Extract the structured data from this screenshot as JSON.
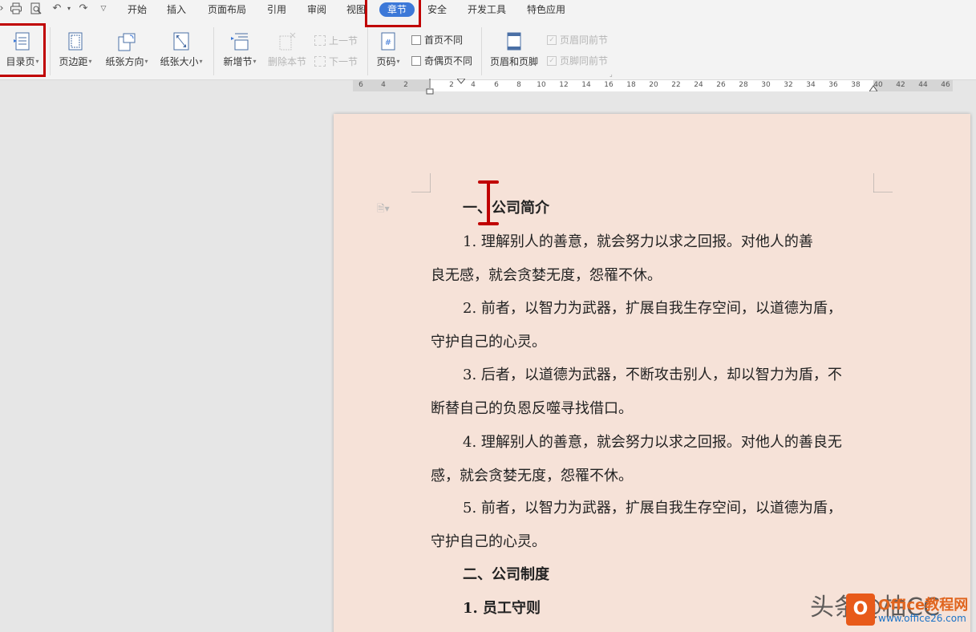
{
  "menu": {
    "items": [
      "开始",
      "插入",
      "页面布局",
      "引用",
      "审阅",
      "视图"
    ],
    "active": "章节",
    "after": [
      "安全",
      "开发工具",
      "特色应用"
    ]
  },
  "quick_access_icons": [
    "print-icon",
    "print-preview-icon",
    "undo-icon",
    "redo-icon",
    "customize-icon"
  ],
  "ribbon": {
    "toc_page": "目录页",
    "margins": "页边距",
    "orientation": "纸张方向",
    "paper_size": "纸张大小",
    "new_section": "新增节",
    "delete_section": "删除本节",
    "prev_section": "上一节",
    "next_section": "下一节",
    "page_number": "页码",
    "first_page_diff": "首页不同",
    "odd_even_diff": "奇偶页不同",
    "header_footer": "页眉和页脚",
    "header_same_prev": "页眉同前节",
    "footer_same_prev": "页脚同前节"
  },
  "ruler_ticks": [
    "6",
    "4",
    "2",
    "2",
    "4",
    "6",
    "8",
    "10",
    "12",
    "14",
    "16",
    "18",
    "20",
    "22",
    "24",
    "26",
    "28",
    "30",
    "32",
    "34",
    "36",
    "38",
    "40",
    "42",
    "44",
    "46"
  ],
  "document": {
    "heading1": "一、公司简介",
    "lines": [
      "1.    理解别人的善意，就会努力以求之回报。对他人的善",
      "良无感，就会贪婪无度，怨罹不休。",
      "2. 前者，以智力为武器，扩展自我生存空间，以道德为盾，",
      "守护自己的心灵。",
      "3. 后者，以道德为武器，不断攻击别人，却以智力为盾，不",
      "断替自己的负恩反噬寻找借口。",
      "4. 理解别人的善意，就会努力以求之回报。对他人的善良无",
      "感，就会贪婪无度，怨罹不休。",
      "5. 前者，以智力为武器，扩展自我生存空间，以道德为盾，",
      "守护自己的心灵。"
    ],
    "heading2": "二、公司制度",
    "heading3": "1. 员工守则"
  },
  "watermark": {
    "text": "头条@柚CC",
    "logo_text": "O",
    "brand": "Office教程网",
    "url": "www.office26.com"
  },
  "colors": {
    "accent": "#3c78d8",
    "highlight_box": "#c00000",
    "page_bg": "#f6e2d8"
  }
}
